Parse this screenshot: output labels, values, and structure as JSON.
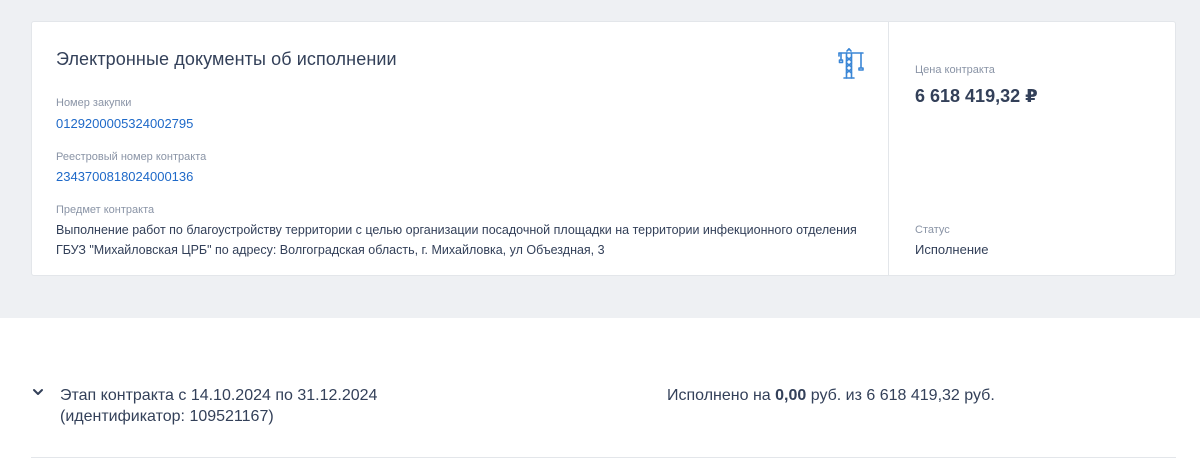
{
  "card": {
    "title": "Электронные документы об исполнении",
    "purchase_number_label": "Номер закупки",
    "purchase_number": "0129200005324002795",
    "registry_number_label": "Реестровый номер контракта",
    "registry_number": "2343700818024000136",
    "subject_label": "Предмет контракта",
    "subject": "Выполнение работ по благоустройству территории с целью организации посадочной площадки на территории инфекционного отделения ГБУЗ \"Михайловская ЦРБ\" по адресу: Волгоградская область, г. Михайловка, ул Объездная, 3",
    "price_label": "Цена контракта",
    "price": "6 618 419,32 ₽",
    "status_label": "Статус",
    "status": "Исполнение",
    "icon": "crane-icon"
  },
  "stage": {
    "title": "Этап контракта с 14.10.2024 по 31.12.2024 (идентификатор: 109521167)",
    "progress_prefix": "Исполнено на ",
    "progress_amount": "0,00",
    "progress_suffix": " руб. из 6 618 419,32 руб.",
    "icon": "chevron-down-icon"
  },
  "colors": {
    "page_bg": "#eef0f3",
    "text": "#334059",
    "label": "#8a94a6",
    "link": "#1e69c8",
    "icon": "#3a86d6"
  }
}
